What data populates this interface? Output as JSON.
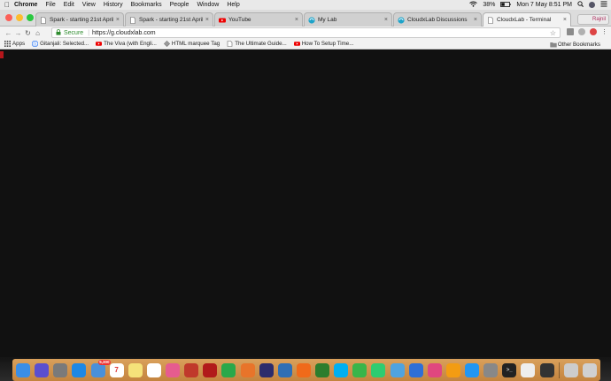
{
  "menubar": {
    "app": "Chrome",
    "items": [
      "File",
      "Edit",
      "View",
      "History",
      "Bookmarks",
      "People",
      "Window",
      "Help"
    ],
    "battery": "38%",
    "clock": "Mon 7 May  8:51 PM"
  },
  "tabs": [
    {
      "title": "Spark - starting 21st April",
      "favicon": "doc-icon",
      "active": false
    },
    {
      "title": "Spark - starting 21st April",
      "favicon": "doc-icon",
      "active": false
    },
    {
      "title": "YouTube",
      "favicon": "youtube-icon",
      "active": false
    },
    {
      "title": "My Lab",
      "favicon": "cloudxlab-icon",
      "active": false
    },
    {
      "title": "CloudxLab Discussions",
      "favicon": "cloudxlab-icon",
      "active": false
    },
    {
      "title": "CloudxLab - Terminal",
      "favicon": "doc-icon",
      "active": true
    }
  ],
  "profile": {
    "name": "Rajnil"
  },
  "omnibox": {
    "secure_label": "Secure",
    "url": "https://g.cloudxlab.com"
  },
  "bookmarks": {
    "apps_label": "Apps",
    "items": [
      {
        "label": "Gitanjali: Selected...",
        "icon": "google-icon"
      },
      {
        "label": "The Viva (with Engli...",
        "icon": "youtube-icon"
      },
      {
        "label": "HTML marquee Tag",
        "icon": "diamond-icon"
      },
      {
        "label": "The Ultimate Guide...",
        "icon": "doc-icon"
      },
      {
        "label": "How To Setup Time...",
        "icon": "youtube-icon"
      }
    ],
    "other_label": "Other Bookmarks"
  },
  "dock": {
    "badge": "5,300",
    "calendar_day": "7",
    "icons": [
      "finder-icon",
      "siri-icon",
      "launchpad-icon",
      "safari-icon",
      "mail-icon",
      "calendar-icon",
      "notes-icon",
      "reminders-icon",
      "photos-icon",
      "photo-booth-icon",
      "acrobat-icon",
      "chrome-icon",
      "firefox-icon",
      "eclipse-icon",
      "virtualbox-icon",
      "sublime-icon",
      "texstudio-icon",
      "skype-icon",
      "messages-icon",
      "facetime-icon",
      "preview-icon",
      "keynote-icon",
      "itunes-icon",
      "ibooks-icon",
      "app-store-icon",
      "system-preferences-icon",
      "terminal-icon",
      "textedit-icon",
      "screenshot-icon",
      "downloads-icon",
      "trash-icon"
    ],
    "colors": [
      "#3a8ee6",
      "#5a4fcf",
      "#7a7a7a",
      "#1e88e5",
      "#4a90d9",
      "#ffffff",
      "#f5e27a",
      "#ffffff",
      "#e65c8f",
      "#c0392b",
      "#b11a1a",
      "#2aa84a",
      "#e8742a",
      "#2c2c6c",
      "#2f6fb5",
      "#f06a1a",
      "#2d7d2d",
      "#00aff0",
      "#39b54a",
      "#2ecc71",
      "#4fa3e0",
      "#2f6fd6",
      "#e0477f",
      "#f39c12",
      "#2196f3",
      "#888888",
      "#222222",
      "#eeeeee",
      "#333333",
      "#cccccc",
      "#d0d0d0"
    ]
  }
}
